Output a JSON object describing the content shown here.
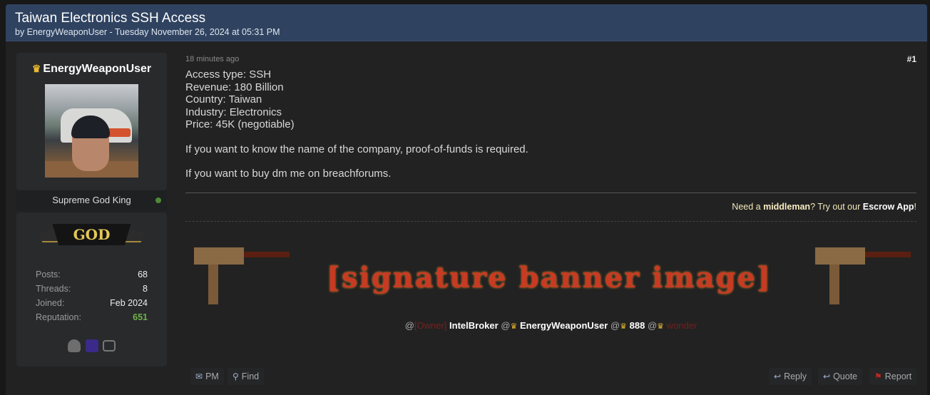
{
  "thread": {
    "title": "Taiwan Electronics SSH Access",
    "subtitle": "by EnergyWeaponUser - Tuesday November 26, 2024 at 05:31 PM"
  },
  "author": {
    "crown_icon": "crown-icon",
    "username": "EnergyWeaponUser",
    "avatar_alt": "user avatar photo",
    "rank": "Supreme God King",
    "status": "online",
    "status_color": "#4d8a3a",
    "badge": "GOD",
    "stats": [
      {
        "label": "Posts:",
        "value": "68"
      },
      {
        "label": "Threads:",
        "value": "8"
      },
      {
        "label": "Joined:",
        "value": "Feb 2024"
      },
      {
        "label": "Reputation:",
        "value": "651"
      }
    ],
    "reputation_color": "#6fb14a",
    "awards": [
      "spy-award-icon",
      "hooded-figure-award-icon",
      "chat-bubbles-award-icon"
    ]
  },
  "post": {
    "time": "18 minutes ago",
    "number": "#1",
    "lines": [
      "Access type: SSH",
      "Revenue: 180 Billion",
      "Country: Taiwan",
      "Industry: Electronics",
      "Price: 45K (negotiable)"
    ],
    "paragraphs": [
      "If you want to know the name of the company, proof-of-funds is required.",
      "If you want to buy dm me on breachforums."
    ]
  },
  "signature": {
    "escrow_prefix": "Need a ",
    "escrow_mid": "middleman",
    "escrow_middle": "? Try out our ",
    "escrow_app": "Escrow App",
    "escrow_suffix": "!",
    "banner_text": "[signature banner image]",
    "mentions": [
      {
        "at": "@",
        "tag": "[Owner]",
        "name": "IntelBroker"
      },
      {
        "at": "@",
        "crown": "♛",
        "name": "EnergyWeaponUser"
      },
      {
        "at": "@",
        "crown": "♛",
        "name": "888"
      },
      {
        "at": "@",
        "crown": "♛",
        "name": "wonder"
      }
    ]
  },
  "actions": {
    "pm": "PM",
    "find": "Find",
    "reply": "Reply",
    "quote": "Quote",
    "report": "Report"
  }
}
